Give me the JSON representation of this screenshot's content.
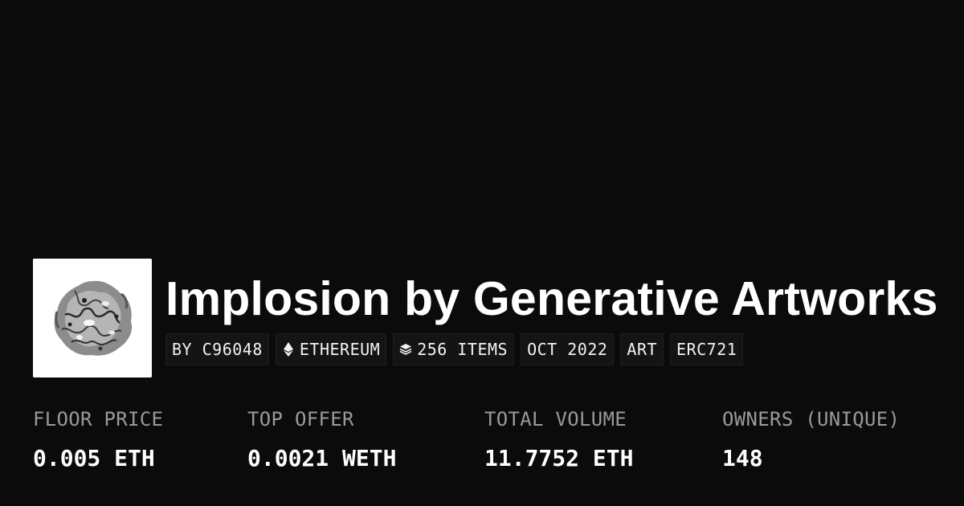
{
  "collection": {
    "title": "Implosion by Generative Artworks",
    "thumbnail_icon": "generative-artwork-thumbnail"
  },
  "chips": [
    {
      "label": "BY C96048",
      "icon": null
    },
    {
      "label": "ETHEREUM",
      "icon": "ethereum-icon"
    },
    {
      "label": "256 ITEMS",
      "icon": "layers-icon"
    },
    {
      "label": "OCT 2022",
      "icon": null
    },
    {
      "label": "ART",
      "icon": null
    },
    {
      "label": "ERC721",
      "icon": null
    }
  ],
  "stats": [
    {
      "label": "FLOOR PRICE",
      "value": "0.005 ETH"
    },
    {
      "label": "TOP OFFER",
      "value": "0.0021 WETH"
    },
    {
      "label": "TOTAL VOLUME",
      "value": "11.7752 ETH"
    },
    {
      "label": "OWNERS (UNIQUE)",
      "value": "148"
    }
  ],
  "colors": {
    "background": "#0b0b0b",
    "chip_background": "#141414",
    "label_gray": "#9a9a9a",
    "text_white": "#ffffff"
  }
}
